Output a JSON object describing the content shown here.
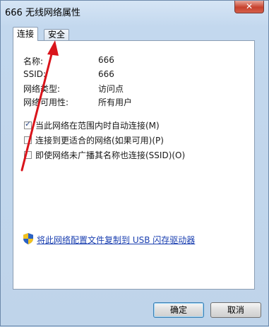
{
  "window": {
    "title": "666 无线网络属性",
    "close_label": "✕"
  },
  "tabs": [
    {
      "label": "连接",
      "active": true
    },
    {
      "label": "安全",
      "active": false
    }
  ],
  "details": [
    {
      "label": "名称:",
      "value": "666"
    },
    {
      "label": "SSID:",
      "value": "666"
    },
    {
      "label": "网络类型:",
      "value": "访问点"
    },
    {
      "label": "网络可用性:",
      "value": "所有用户"
    }
  ],
  "options": [
    {
      "label": "当此网络在范围内时自动连接(M)",
      "checked": true
    },
    {
      "label": "连接到更适合的网络(如果可用)(P)",
      "checked": false
    },
    {
      "label": "即使网络未广播其名称也连接(SSID)(O)",
      "checked": false
    }
  ],
  "copy_link": {
    "label": "将此网络配置文件复制到 USB 闪存驱动器",
    "icon": "uac-shield-icon"
  },
  "buttons": {
    "ok": "确定",
    "cancel": "取消"
  },
  "colors": {
    "annotation": "#d9141b",
    "link": "#1a3fb0"
  }
}
